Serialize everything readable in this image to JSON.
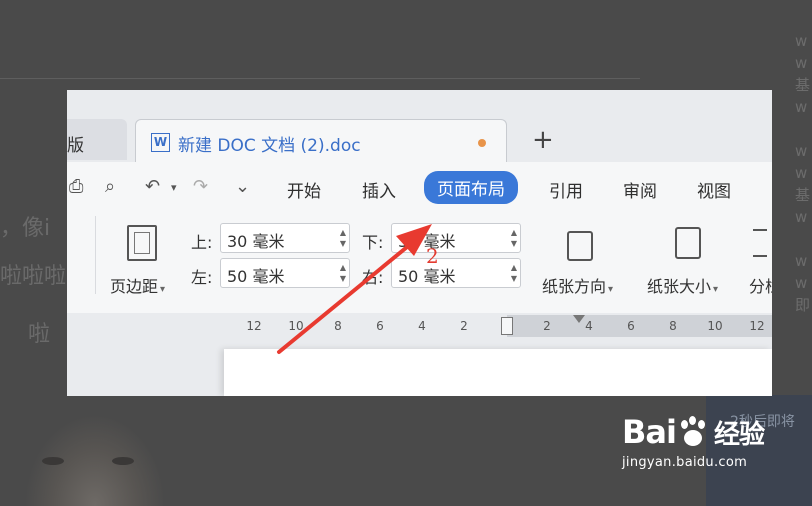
{
  "background": {
    "text_line1": "，像i",
    "text_line2": "啦啦啦",
    "text_line3": "啦",
    "right_column": [
      "w",
      "w",
      "基",
      "w",
      "w",
      "w",
      "基",
      "w",
      "w",
      "w",
      "即"
    ],
    "timer_text": "2秒后即将"
  },
  "watermark": {
    "brand_left": "Bai",
    "brand_right": "经验",
    "url": "jingyan.baidu.com"
  },
  "tabs": {
    "prev_label": "版",
    "active_icon": "W",
    "active_title": "新建 DOC 文档 (2).doc",
    "add": "+"
  },
  "quick_access": {
    "print": "⎙",
    "preview": "⌕",
    "undo": "↶",
    "undo_caret": "▾",
    "redo": "↷",
    "more": "⌄"
  },
  "menu": {
    "start": "开始",
    "insert": "插入",
    "page_layout": "页面布局",
    "references": "引用",
    "review": "审阅",
    "view": "视图"
  },
  "ribbon": {
    "margins_label": "页边距",
    "top_label": "上:",
    "top_value": "30 毫米",
    "bottom_label": "下:",
    "bottom_value": "30 毫米",
    "left_label": "左:",
    "left_value": "50 毫米",
    "right_label": "右:",
    "right_value": "50 毫米",
    "orientation_label": "纸张方向",
    "size_label": "纸张大小",
    "columns_label": "分栏",
    "caret": "▾"
  },
  "ruler": {
    "left_ticks": [
      "12",
      "10",
      "8",
      "6",
      "4",
      "2"
    ],
    "right_ticks": [
      "2",
      "4",
      "6",
      "8",
      "10",
      "12"
    ]
  },
  "annotation": {
    "step_number": "2",
    "arrow_color": "#e83a30"
  },
  "colors": {
    "accent": "#3a78d8",
    "tab_title": "#3a6fc8",
    "unsaved_dot": "#e8944a"
  }
}
